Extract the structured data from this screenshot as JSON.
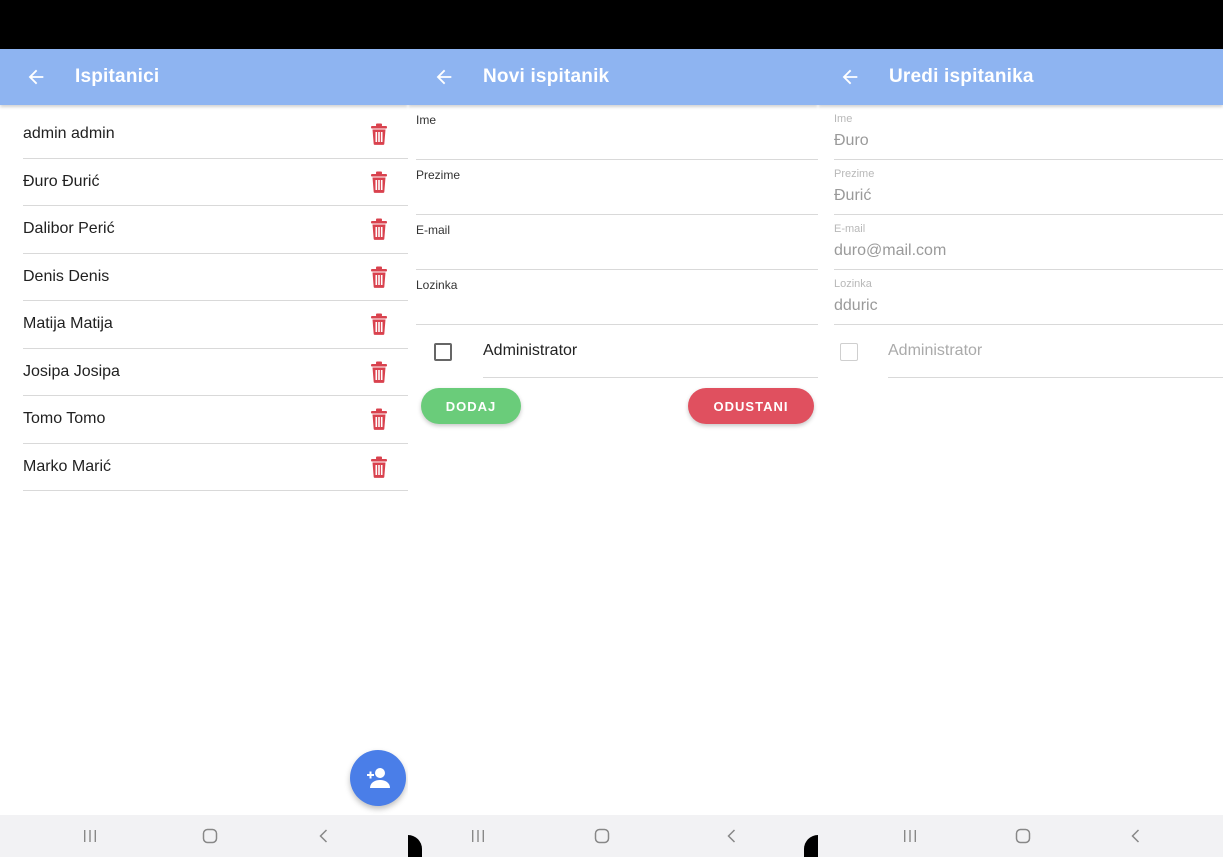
{
  "colors": {
    "appbar": "#8eb4f1",
    "trash": "#d9424e",
    "fab": "#4a7ee8",
    "add_button": "#6acc7a",
    "cancel_button": "#e0505f"
  },
  "screen_list": {
    "title": "Ispitanici",
    "items": [
      {
        "name": "admin admin"
      },
      {
        "name": "Đuro Đurić"
      },
      {
        "name": "Dalibor Perić"
      },
      {
        "name": "Denis Denis"
      },
      {
        "name": "Matija Matija"
      },
      {
        "name": "Josipa Josipa"
      },
      {
        "name": "Tomo Tomo"
      },
      {
        "name": "Marko Marić"
      }
    ],
    "row_icon": "trash-icon",
    "fab_icon": "add-person-icon"
  },
  "screen_new": {
    "title": "Novi ispitanik",
    "fields": [
      {
        "label": "Ime",
        "value": ""
      },
      {
        "label": "Prezime",
        "value": ""
      },
      {
        "label": "E-mail",
        "value": ""
      },
      {
        "label": "Lozinka",
        "value": ""
      }
    ],
    "checkbox_label": "Administrator",
    "add_label": "DODAJ",
    "cancel_label": "ODUSTANI"
  },
  "screen_edit": {
    "title": "Uredi ispitanika",
    "fields": [
      {
        "label": "Ime",
        "value": "Đuro"
      },
      {
        "label": "Prezime",
        "value": "Đurić"
      },
      {
        "label": "E-mail",
        "value": "duro@mail.com"
      },
      {
        "label": "Lozinka",
        "value": "dduric"
      }
    ],
    "checkbox_label": "Administrator"
  },
  "navbar": {
    "icons": [
      "recent-apps-icon",
      "home-icon",
      "back-nav-icon"
    ]
  }
}
